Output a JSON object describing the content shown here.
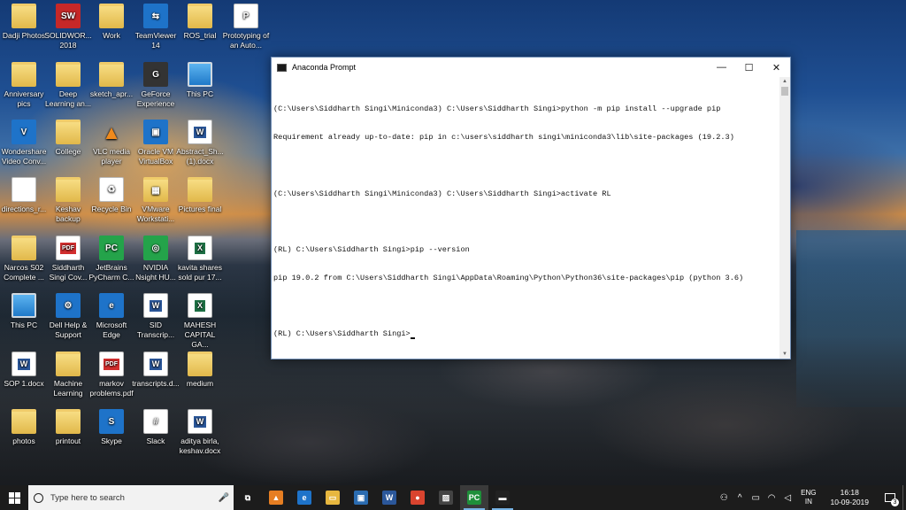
{
  "desktop": {
    "icons": [
      {
        "label": "Dadji Photos",
        "icon": "folder-photos-icon"
      },
      {
        "label": "SOLIDWOR... 2018",
        "icon": "solidworks-icon"
      },
      {
        "label": "Work",
        "icon": "folder-icon"
      },
      {
        "label": "TeamViewer 14",
        "icon": "teamviewer-icon"
      },
      {
        "label": "ROS_trial",
        "icon": "folder-icon"
      },
      {
        "label": "Prototyping of an Auto...",
        "icon": "powerpoint-icon"
      },
      {
        "label": "Anniversary pics",
        "icon": "folder-icon"
      },
      {
        "label": "Deep Learning an...",
        "icon": "folder-icon"
      },
      {
        "label": "sketch_apr...",
        "icon": "folder-icon"
      },
      {
        "label": "GeForce Experience",
        "icon": "geforce-icon"
      },
      {
        "label": "This PC",
        "icon": "this-pc-icon"
      },
      {
        "label": "Wondershare Video Conv...",
        "icon": "wondershare-icon"
      },
      {
        "label": "College",
        "icon": "folder-icon"
      },
      {
        "label": "VLC media player",
        "icon": "vlc-icon"
      },
      {
        "label": "Oracle VM VirtualBox",
        "icon": "virtualbox-icon"
      },
      {
        "label": "Abstract_Sh... (1).docx",
        "icon": "word-doc-icon"
      },
      {
        "label": "directions_r...",
        "icon": "file-icon"
      },
      {
        "label": "Keshav backup",
        "icon": "folder-icon"
      },
      {
        "label": "Recycle Bin",
        "icon": "recycle-bin-icon"
      },
      {
        "label": "VMware Workstati...",
        "icon": "vmware-icon"
      },
      {
        "label": "Pictures final",
        "icon": "folder-icon"
      },
      {
        "label": "Narcos S02 Complete ...",
        "icon": "folder-icon"
      },
      {
        "label": "Siddharth Singi Cov...",
        "icon": "pdf-icon"
      },
      {
        "label": "JetBrains PyCharm C...",
        "icon": "pycharm-icon"
      },
      {
        "label": "NVIDIA Nsight HU...",
        "icon": "nvidia-icon"
      },
      {
        "label": "kavita shares sold pur 17...",
        "icon": "excel-icon"
      },
      {
        "label": "This PC",
        "icon": "this-pc-icon"
      },
      {
        "label": "Dell Help & Support",
        "icon": "dell-help-icon"
      },
      {
        "label": "Microsoft Edge",
        "icon": "edge-icon"
      },
      {
        "label": "SID Transcrip...",
        "icon": "word-doc-icon"
      },
      {
        "label": "MAHESH CAPITAL GA...",
        "icon": "excel-icon"
      },
      {
        "label": "SOP 1.docx",
        "icon": "word-doc-icon"
      },
      {
        "label": "Machine Learning",
        "icon": "folder-icon"
      },
      {
        "label": "markov problems.pdf",
        "icon": "pdf-icon"
      },
      {
        "label": "transcripts.d...",
        "icon": "word-doc-icon"
      },
      {
        "label": "medium",
        "icon": "folder-icon"
      },
      {
        "label": "photos",
        "icon": "folder-icon"
      },
      {
        "label": "printout",
        "icon": "folder-icon"
      },
      {
        "label": "Skype",
        "icon": "skype-icon"
      },
      {
        "label": "Slack",
        "icon": "slack-icon"
      },
      {
        "label": "aditya birla, keshav.docx",
        "icon": "word-doc-icon"
      }
    ]
  },
  "console": {
    "title": "Anaconda Prompt",
    "lines": [
      "(C:\\Users\\Siddharth Singi\\Miniconda3) C:\\Users\\Siddharth Singi>python -m pip install --upgrade pip",
      "Requirement already up-to-date: pip in c:\\users\\siddharth singi\\miniconda3\\lib\\site-packages (19.2.3)",
      "",
      "(C:\\Users\\Siddharth Singi\\Miniconda3) C:\\Users\\Siddharth Singi>activate RL",
      "",
      "(RL) C:\\Users\\Siddharth Singi>pip --version",
      "pip 19.0.2 from C:\\Users\\Siddharth Singi\\AppData\\Roaming\\Python\\Python36\\site-packages\\pip (python 3.6)",
      "",
      "(RL) C:\\Users\\Siddharth Singi>"
    ],
    "buttons": {
      "minimize": "—",
      "maximize": "☐",
      "close": "✕"
    }
  },
  "taskbar": {
    "search_placeholder": "Type here to search",
    "apps": [
      {
        "icon": "task-view-icon",
        "glyph": "⧉",
        "color": "#1c1c1c",
        "running": false
      },
      {
        "icon": "vlc-icon",
        "glyph": "▲",
        "color": "#e67e22",
        "running": false
      },
      {
        "icon": "edge-icon",
        "glyph": "e",
        "color": "#1e73c9",
        "running": false
      },
      {
        "icon": "file-explorer-icon",
        "glyph": "▭",
        "color": "#e7b73f",
        "running": false
      },
      {
        "icon": "store-icon",
        "glyph": "▣",
        "color": "#2b6cb0",
        "running": false
      },
      {
        "icon": "word-icon",
        "glyph": "W",
        "color": "#2b579a",
        "running": false
      },
      {
        "icon": "chrome-icon",
        "glyph": "●",
        "color": "#d9442f",
        "running": false
      },
      {
        "icon": "photos-icon",
        "glyph": "▨",
        "color": "#444",
        "running": false
      },
      {
        "icon": "pycharm-icon",
        "glyph": "PC",
        "color": "#1f8f3a",
        "running": true
      },
      {
        "icon": "anaconda-prompt-icon",
        "glyph": "▬",
        "color": "#222",
        "running": true
      }
    ],
    "tray": {
      "language_top": "ENG",
      "language_bottom": "IN",
      "time": "16:18",
      "date": "10-09-2019",
      "notification_count": "3"
    }
  }
}
